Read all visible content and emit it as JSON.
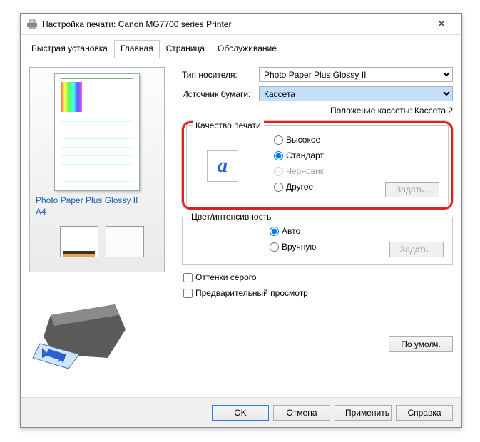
{
  "window": {
    "title": "Настройка печати: Canon MG7700 series Printer"
  },
  "tabs": {
    "quick": "Быстрая установка",
    "main": "Главная",
    "page": "Страница",
    "service": "Обслуживание"
  },
  "preview": {
    "paper_info": "Photo Paper Plus Glossy II\nA4"
  },
  "media": {
    "type_label": "Тип носителя:",
    "type_value": "Photo Paper Plus Glossy II",
    "source_label": "Источник бумаги:",
    "source_value": "Кассета",
    "position_text": "Положение кассеты: Кассета 2"
  },
  "quality": {
    "legend": "Качество печати",
    "high": "Высокое",
    "standard": "Стандарт",
    "draft": "Черновик",
    "other": "Другое",
    "set_btn": "Задать..."
  },
  "color": {
    "legend": "Цвет/интенсивность",
    "auto": "Авто",
    "manual": "Вручную",
    "set_btn": "Задать..."
  },
  "checks": {
    "grayscale": "Оттенки серого",
    "preview": "Предварительный просмотр"
  },
  "defaults_btn": "По умолч.",
  "footer": {
    "ok": "OK",
    "cancel": "Отмена",
    "apply": "Применить",
    "help": "Справка"
  }
}
